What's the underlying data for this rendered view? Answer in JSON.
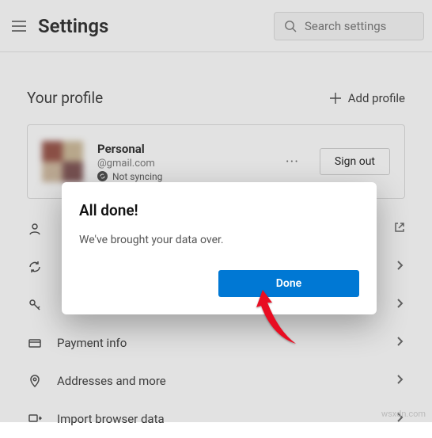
{
  "header": {
    "title": "Settings",
    "search_placeholder": "Search settings"
  },
  "profile_section": {
    "heading": "Your profile",
    "add_label": "Add profile"
  },
  "profile_card": {
    "name": "Personal",
    "email": "@gmail.com",
    "sync_status": "Not syncing",
    "signout_label": "Sign out"
  },
  "rows": [
    {
      "label": ""
    },
    {
      "label": ""
    },
    {
      "label": ""
    },
    {
      "label": "Payment info"
    },
    {
      "label": "Addresses and more"
    },
    {
      "label": "Import browser data"
    }
  ],
  "dialog": {
    "title": "All done!",
    "body": "We've brought your data over.",
    "done_label": "Done"
  },
  "watermark": "wsxdn.com"
}
